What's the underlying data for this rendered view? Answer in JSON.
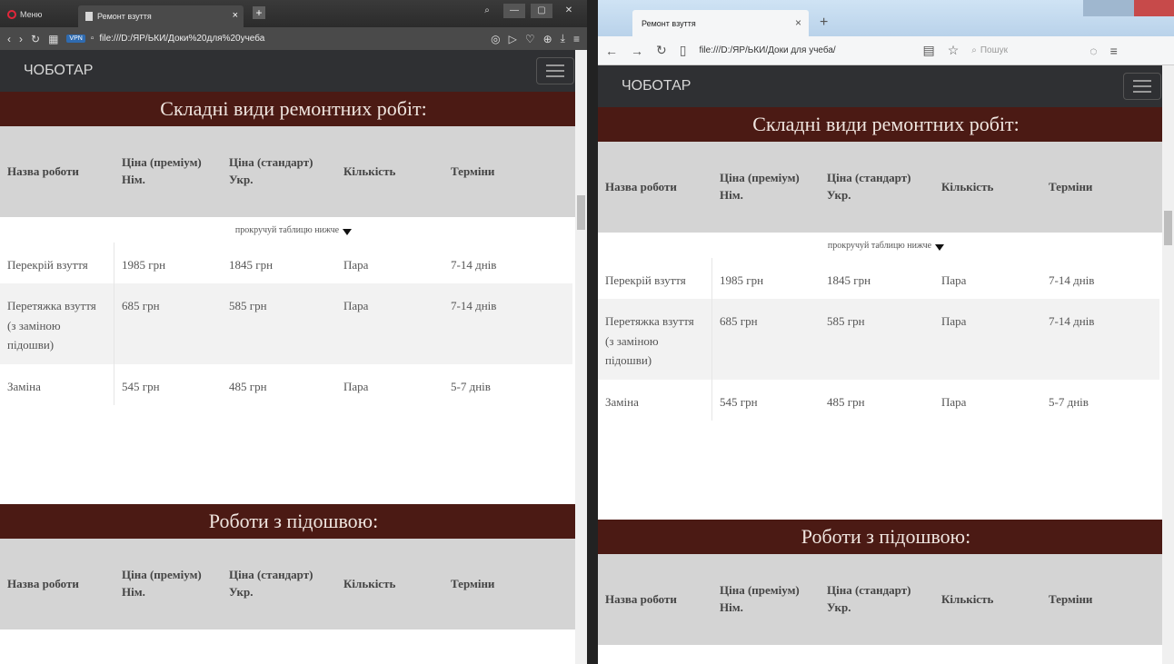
{
  "opera": {
    "menu_label": "Меню",
    "tab_title": "Ремонт взуття",
    "url": "file:///D:/ЯР/ЬКИ/Доки%20для%20учеба",
    "tab_close": "×",
    "new_tab": "+"
  },
  "firefox": {
    "tab_title": "Ремонт взуття",
    "url": "file:///D:/ЯР/ЬКИ/Доки для учеба/",
    "search_placeholder": "Пошук",
    "tab_close": "×",
    "new_tab": "+"
  },
  "page": {
    "brand": "ЧОБОТАР",
    "section1_title": "Складні види ремонтних робіт:",
    "section2_title": "Роботи з підошвою:",
    "headers": [
      "Назва роботи",
      "Ціна (преміум) Нім.",
      "Ціна (стандарт) Укр.",
      "Кількість",
      "Терміни"
    ],
    "scroll_hint": "прокручуй таблицю нижче",
    "rows": [
      [
        "Перекрій взуття",
        "1985 грн",
        "1845 грн",
        "Пара",
        "7-14 днів"
      ],
      [
        "Перетяжка взуття (з заміною підошви)",
        "685 грн",
        "585 грн",
        "Пара",
        "7-14 днів"
      ],
      [
        "Заміна",
        "545 грн",
        "485 грн",
        "Пара",
        "5-7 днів"
      ]
    ]
  },
  "colors": {
    "navbar": "#2f3033",
    "section_bar": "#4b1a14",
    "table_header": "#d4d4d4"
  }
}
